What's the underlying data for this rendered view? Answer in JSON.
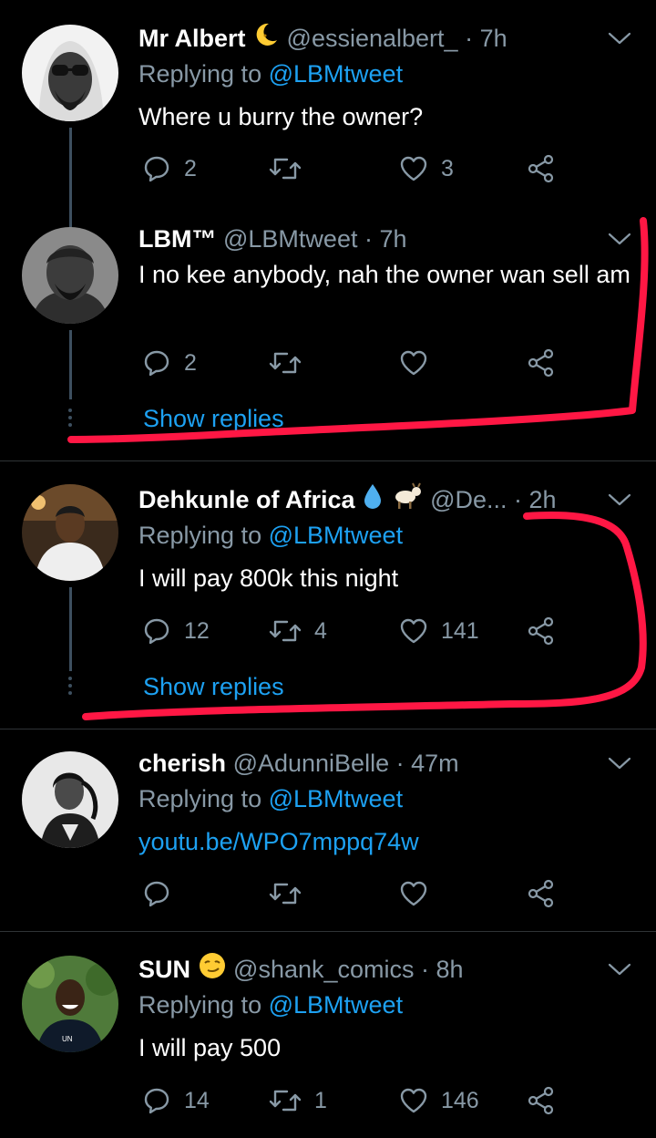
{
  "tweets": [
    {
      "name": "Mr Albert",
      "handle": "@essienalbert_",
      "time": "· 7h",
      "replying_label": "Replying to",
      "replying_to": "@LBMtweet",
      "text": "Where u burry the owner?",
      "replies": "2",
      "retweets": "",
      "likes": "3"
    },
    {
      "name": "LBM™",
      "handle": "@LBMtweet",
      "time": "· 7h",
      "text": "I no kee anybody, nah the owner wan sell am",
      "replies": "2",
      "retweets": "",
      "likes": "",
      "show_replies": "Show replies"
    },
    {
      "name": "Dehkunle of Africa",
      "handle": "@De...",
      "time": "· 2h",
      "replying_label": "Replying to",
      "replying_to": "@LBMtweet",
      "text": "I will pay 800k this night",
      "replies": "12",
      "retweets": "4",
      "likes": "141",
      "show_replies": "Show replies"
    },
    {
      "name": "cherish",
      "handle": "@AdunniBelle",
      "time": "· 47m",
      "replying_label": "Replying to",
      "replying_to": "@LBMtweet",
      "text": "youtu.be/WPO7mppq74w",
      "replies": "",
      "retweets": "",
      "likes": ""
    },
    {
      "name": "SUN",
      "handle": "@shank_comics",
      "time": "· 8h",
      "replying_label": "Replying to",
      "replying_to": "@LBMtweet",
      "text": "I will pay 500",
      "replies": "14",
      "retweets": "1",
      "likes": "146"
    }
  ],
  "colors": {
    "background": "#000000",
    "text": "#ffffff",
    "secondary": "#8899a6",
    "link": "#1da1f2",
    "annotation": "#ff1744"
  },
  "icons": [
    "reply-icon",
    "retweet-icon",
    "like-icon",
    "share-icon",
    "chevron-down-icon",
    "moon-emoji",
    "droplet-emoji",
    "goat-emoji",
    "smirk-emoji"
  ]
}
